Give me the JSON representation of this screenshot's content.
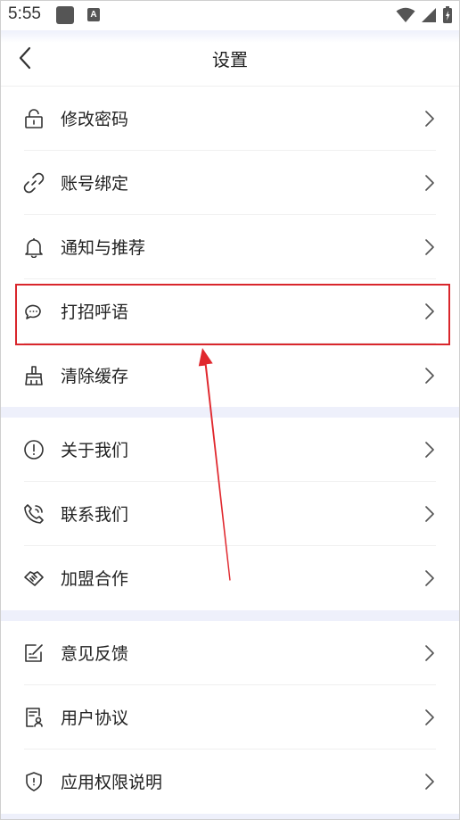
{
  "status_bar": {
    "time": "5:55",
    "notification_letter": "A"
  },
  "header": {
    "title": "设置",
    "back_icon": "chevron-left-icon"
  },
  "sections": [
    {
      "items": [
        {
          "label": "修改密码",
          "icon": "lock-icon"
        },
        {
          "label": "账号绑定",
          "icon": "link-icon"
        },
        {
          "label": "通知与推荐",
          "icon": "bell-icon"
        },
        {
          "label": "打招呼语",
          "icon": "chat-bubbles-icon"
        },
        {
          "label": "清除缓存",
          "icon": "broom-icon"
        }
      ]
    },
    {
      "items": [
        {
          "label": "关于我们",
          "icon": "info-circle-icon"
        },
        {
          "label": "联系我们",
          "icon": "phone-icon"
        },
        {
          "label": "加盟合作",
          "icon": "handshake-icon"
        }
      ]
    },
    {
      "items": [
        {
          "label": "意见反馈",
          "icon": "feedback-edit-icon"
        },
        {
          "label": "用户协议",
          "icon": "document-user-icon"
        },
        {
          "label": "应用权限说明",
          "icon": "shield-icon"
        }
      ]
    }
  ],
  "annotation": {
    "highlighted_item": "打招呼语",
    "highlight_color": "#d9262c",
    "arrow_color": "#e0282e"
  },
  "colors": {
    "section_gap": "#eef0fb",
    "text": "#222222",
    "icon": "#333333"
  }
}
